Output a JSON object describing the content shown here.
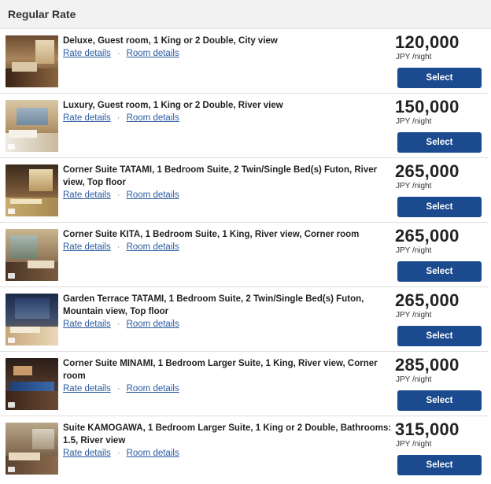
{
  "section": {
    "title": "Regular Rate"
  },
  "labels": {
    "rate_details": "Rate details",
    "separator": "·",
    "room_details": "Room details",
    "select": "Select"
  },
  "rooms": [
    {
      "name": "Deluxe, Guest room, 1 King or 2 Double, City view",
      "price": "120,000",
      "unit": "JPY /night"
    },
    {
      "name": "Luxury, Guest room, 1 King or 2 Double, River view",
      "price": "150,000",
      "unit": "JPY /night"
    },
    {
      "name": "Corner Suite TATAMI, 1 Bedroom Suite, 2 Twin/Single Bed(s) Futon, River view, Top floor",
      "price": "265,000",
      "unit": "JPY /night"
    },
    {
      "name": "Corner Suite KITA, 1 Bedroom Suite, 1 King, River view, Corner room",
      "price": "265,000",
      "unit": "JPY /night"
    },
    {
      "name": "Garden Terrace TATAMI, 1 Bedroom Suite, 2 Twin/Single Bed(s) Futon, Mountain view, Top floor",
      "price": "265,000",
      "unit": "JPY /night"
    },
    {
      "name": "Corner Suite MINAMI, 1 Bedroom Larger Suite, 1 King, River view, Corner room",
      "price": "285,000",
      "unit": "JPY /night"
    },
    {
      "name": "Suite KAMOGAWA, 1 Bedroom Larger Suite, 1 King or 2 Double, Bathrooms: 1.5, River view",
      "price": "315,000",
      "unit": "JPY /night"
    }
  ]
}
